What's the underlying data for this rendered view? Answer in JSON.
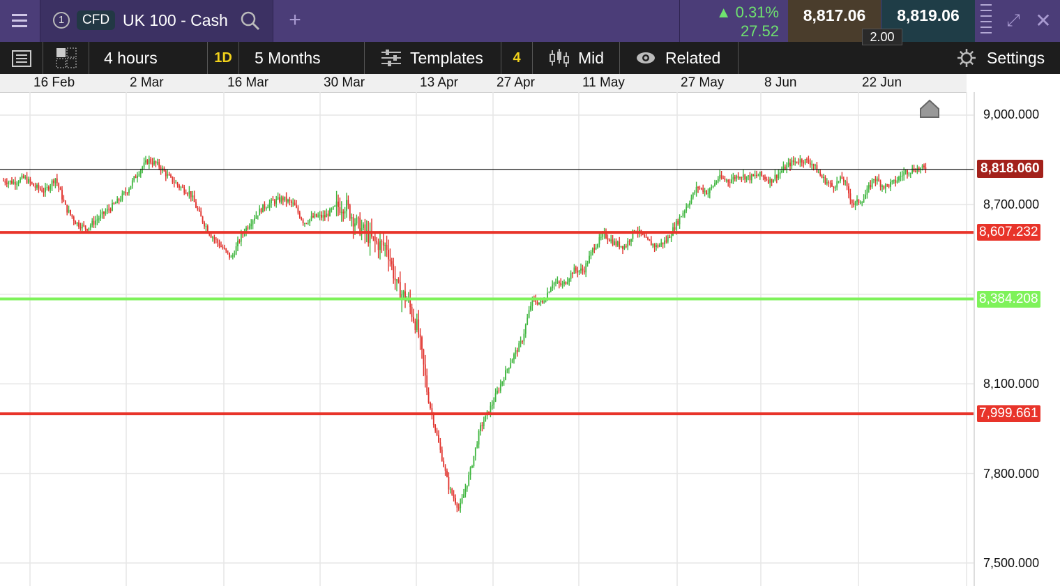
{
  "header": {
    "tab_number": "1",
    "instrument_type": "CFD",
    "instrument_name": "UK 100 - Cash",
    "change_pct": "0.31%",
    "change_abs": "27.52",
    "sell_price": "8,817.06",
    "buy_price": "8,819.06",
    "spread": "2.00"
  },
  "toolbar": {
    "interval": "4 hours",
    "period_badge": "1D",
    "range": "5 Months",
    "templates": "Templates",
    "indicator_count": "4",
    "price_type": "Mid",
    "related": "Related",
    "settings": "Settings"
  },
  "dates": [
    "16 Feb",
    "2 Mar",
    "16 Mar",
    "30 Mar",
    "13 Apr",
    "27 Apr",
    "11 May",
    "27 May",
    "8 Jun",
    "22 Jun"
  ],
  "chart_data": {
    "type": "candlestick",
    "instrument": "UK 100 - Cash",
    "interval": "4 hours",
    "x_range": [
      "16 Feb",
      "22 Jun"
    ],
    "ylim": [
      7450,
      9050
    ],
    "y_ticks": [
      "9,000.000",
      "8,700.000",
      "8,100.000",
      "7,800.000",
      "7,500.000"
    ],
    "y_tick_values": [
      9000,
      8700,
      8100,
      7800,
      7500
    ],
    "current_price": "8,818.060",
    "current_price_value": 8818.06,
    "levels": [
      {
        "label": "8,607.232",
        "value": 8607.232,
        "color": "#e8342a"
      },
      {
        "label": "8,384.208",
        "value": 8384.208,
        "color": "#7ef25a"
      },
      {
        "label": "7,999.661",
        "value": 7999.661,
        "color": "#e8342a"
      }
    ],
    "up_color": "#3db53d",
    "down_color": "#e0312b",
    "path_closes": [
      [
        8780,
        8775
      ],
      [
        8790,
        8760
      ],
      [
        8745,
        8790
      ],
      [
        8690,
        8640
      ],
      [
        8620,
        8650
      ],
      [
        8680,
        8710
      ],
      [
        8750,
        8810
      ],
      [
        8850,
        8830
      ],
      [
        8790,
        8760
      ],
      [
        8740,
        8660
      ],
      [
        8600,
        8560
      ],
      [
        8520,
        8600
      ],
      [
        8650,
        8690
      ],
      [
        8710,
        8720
      ],
      [
        8700,
        8640
      ],
      [
        8660,
        8660
      ],
      [
        8690,
        8700
      ],
      [
        8640,
        8600
      ],
      [
        8570,
        8560
      ],
      [
        8420,
        8380
      ],
      [
        8280,
        8050
      ],
      [
        7900,
        7750
      ],
      [
        7680,
        7800
      ],
      [
        7950,
        8020
      ],
      [
        8100,
        8180
      ],
      [
        8240,
        8380
      ],
      [
        8370,
        8440
      ],
      [
        8430,
        8480
      ],
      [
        8480,
        8560
      ],
      [
        8600,
        8570
      ],
      [
        8560,
        8620
      ],
      [
        8580,
        8560
      ],
      [
        8580,
        8640
      ],
      [
        8700,
        8760
      ],
      [
        8740,
        8790
      ],
      [
        8780,
        8800
      ],
      [
        8790,
        8800
      ],
      [
        8780,
        8810
      ],
      [
        8840,
        8850
      ],
      [
        8840,
        8790
      ],
      [
        8760,
        8790
      ],
      [
        8700,
        8720
      ],
      [
        8790,
        8760
      ],
      [
        8775,
        8810
      ],
      [
        8820,
        8820
      ]
    ]
  }
}
